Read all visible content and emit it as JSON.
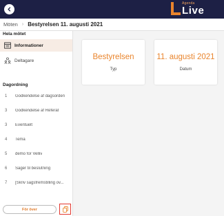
{
  "app": {
    "logo_small": "Agenda",
    "logo_big": "Live",
    "brand_color": "#1d2045",
    "accent_color": "#e9842c"
  },
  "breadcrumb": {
    "root": "Möten",
    "separator": "›",
    "current": "Bestyrelsen 11. augusti 2021"
  },
  "sidebar": {
    "section_meeting": "Hela mötet",
    "items": [
      {
        "label": "Informationer",
        "icon": "calendar-icon",
        "active": true
      },
      {
        "label": "Deltagare",
        "icon": "participants-icon",
        "active": false
      }
    ],
    "section_agenda": "Dagordning",
    "agenda": [
      {
        "num": "1",
        "label": "Godkendelse af dagsorden"
      },
      {
        "num": "3",
        "label": "Godkendelse af Referat"
      },
      {
        "num": "3",
        "label": "Eventuelt"
      },
      {
        "num": "4",
        "label": "Tema"
      },
      {
        "num": "5",
        "label": "demo for Velliv"
      },
      {
        "num": "6",
        "label": "Sager til beslutning"
      },
      {
        "num": "7",
        "label": "[Skriv sagsfremstilling ov..."
      }
    ],
    "lead_button": "För över"
  },
  "cards": [
    {
      "value": "Bestyrelsen",
      "label": "Typ"
    },
    {
      "value": "11. augusti 2021",
      "label": "Datum"
    }
  ]
}
